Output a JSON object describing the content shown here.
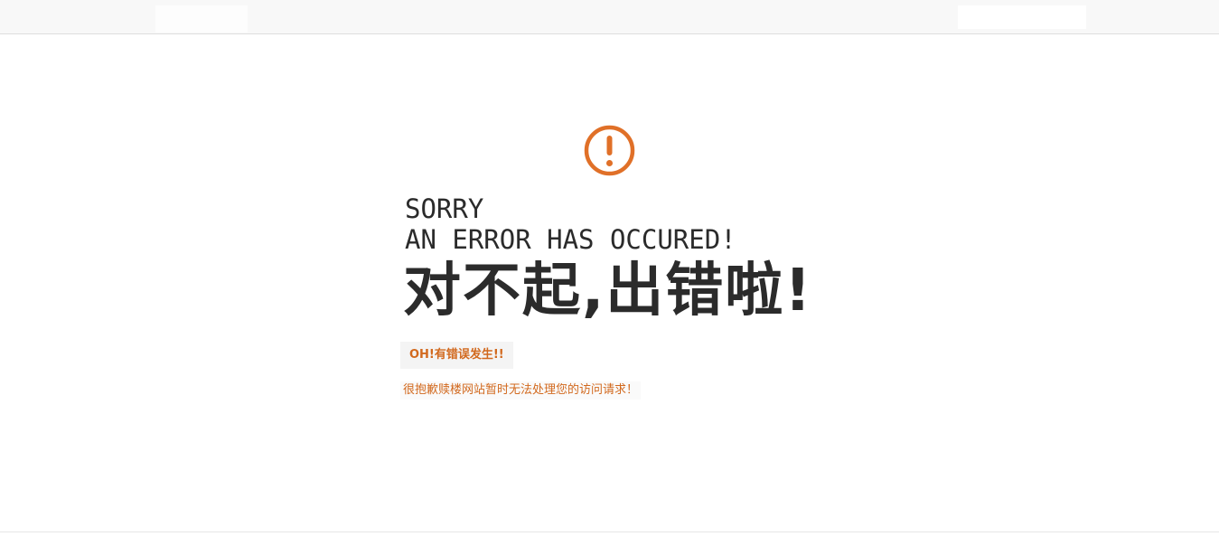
{
  "error": {
    "icon": "exclamation-circle-icon",
    "accent_color": "#e07028",
    "title_en_line1": "SORRY",
    "title_en_line2": "AN ERROR HAS OCCURED!",
    "title_cn": "对不起,出错啦!",
    "badge": "OH!有错误发生!!",
    "message": "很抱歉赎楼网站暂时无法处理您的访问请求！"
  }
}
